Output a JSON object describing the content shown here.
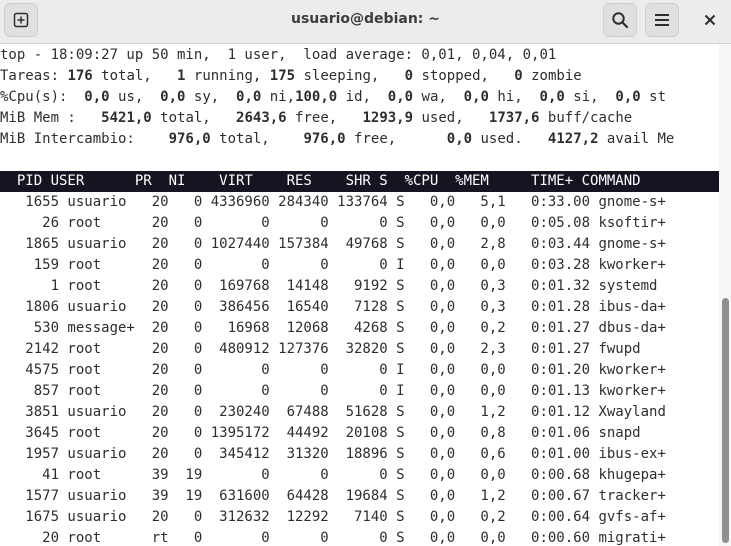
{
  "window": {
    "title": "usuario@debian: ~",
    "new_tab_icon": "new-tab-icon",
    "search_icon": "search-icon",
    "menu_icon": "hamburger-menu-icon",
    "close_icon": "close-icon"
  },
  "summary": {
    "line1": "top - 18:09:27 up 50 min,  1 user,  load average: 0,01, 0,04, 0,01",
    "tasks": {
      "label": "Tareas: ",
      "total": "176",
      "total_label": " total,   ",
      "running": "1",
      "running_label": " running, ",
      "sleeping": "175",
      "sleeping_label": " sleeping,   ",
      "stopped": "0",
      "stopped_label": " stopped,   ",
      "zombie": "0",
      "zombie_label": " zombie"
    },
    "cpu": {
      "label": "%Cpu(s):  ",
      "us": "0,0",
      "us_label": " us,  ",
      "sy": "0,0",
      "sy_label": " sy,  ",
      "ni": "0,0",
      "ni_label": " ni,",
      "id": "100,0",
      "id_label": " id,  ",
      "wa": "0,0",
      "wa_label": " wa,  ",
      "hi": "0,0",
      "hi_label": " hi,  ",
      "si": "0,0",
      "si_label": " si,  ",
      "st": "0,0",
      "st_label": " st"
    },
    "mem": {
      "label": "MiB Mem :   ",
      "total": "5421,0",
      "total_label": " total,   ",
      "free": "2643,6",
      "free_label": " free,   ",
      "used": "1293,9",
      "used_label": " used,   ",
      "cache": "1737,6",
      "cache_label": " buff/cache"
    },
    "swap": {
      "label": "MiB Intercambio:    ",
      "total": "976,0",
      "total_label": " total,    ",
      "free": "976,0",
      "free_label": " free,      ",
      "used": "0,0",
      "used_label": " used.   ",
      "avail": "4127,2",
      "avail_label": " avail Me"
    }
  },
  "header_line": "  PID USER      PR  NI    VIRT    RES    SHR S  %CPU  %MEM     TIME+ COMMAND",
  "processes": [
    "   1655 usuario   20   0 4336960 284340 133764 S   0,0   5,1   0:33.00 gnome-s+",
    "     26 root      20   0       0      0      0 S   0,0   0,0   0:05.08 ksoftir+",
    "   1865 usuario   20   0 1027440 157384  49768 S   0,0   2,8   0:03.44 gnome-s+",
    "    159 root      20   0       0      0      0 I   0,0   0,0   0:03.28 kworker+",
    "      1 root      20   0  169768  14148   9192 S   0,0   0,3   0:01.32 systemd",
    "   1806 usuario   20   0  386456  16540   7128 S   0,0   0,3   0:01.28 ibus-da+",
    "    530 message+  20   0   16968  12068   4268 S   0,0   0,2   0:01.27 dbus-da+",
    "   2142 root      20   0  480912 127376  32820 S   0,0   2,3   0:01.27 fwupd",
    "   4575 root      20   0       0      0      0 I   0,0   0,0   0:01.20 kworker+",
    "    857 root      20   0       0      0      0 I   0,0   0,0   0:01.13 kworker+",
    "   3851 usuario   20   0  230240  67488  51628 S   0,0   1,2   0:01.12 Xwayland",
    "   3645 root      20   0 1395172  44492  20108 S   0,0   0,8   0:01.06 snapd",
    "   1957 usuario   20   0  345412  31320  18896 S   0,0   0,6   0:01.00 ibus-ex+",
    "     41 root      39  19       0      0      0 S   0,0   0,0   0:00.68 khugepa+",
    "   1577 usuario   39  19  631600  64428  19684 S   0,0   1,2   0:00.67 tracker+",
    "   1675 usuario   20   0  312632  12292   7140 S   0,0   0,2   0:00.64 gvfs-af+",
    "     20 root      rt   0       0      0      0 S   0,0   0,0   0:00.60 migrati+"
  ]
}
